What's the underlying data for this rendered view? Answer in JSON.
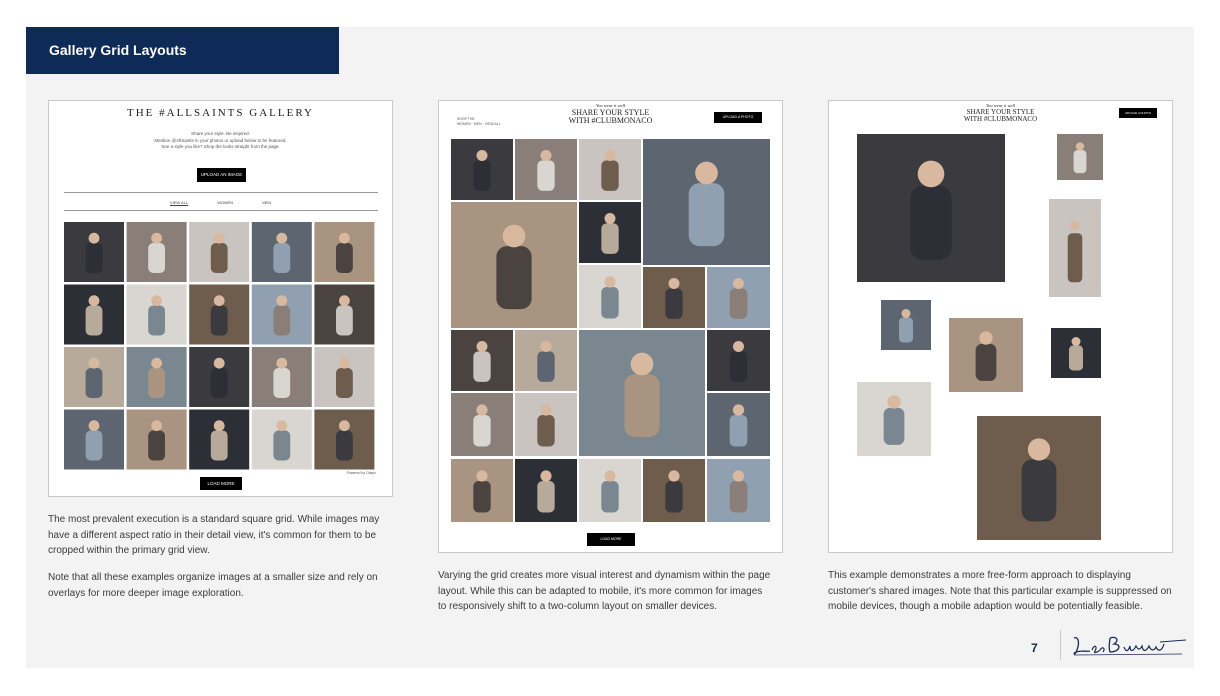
{
  "slide": {
    "title": "Gallery Grid Layouts",
    "page_number": "7",
    "logo_text": "Leo Burnett"
  },
  "panel1": {
    "title": "THE #ALLSAINTS GALLERY",
    "intro_lines": [
      "Share your style. Be inspired.",
      "Mention @AllSaints in your photos or upload below to be featured.",
      "See a style you like? Shop the looks straight from the page."
    ],
    "upload_button": "UPLOAD AN IMAGE",
    "filters": [
      "VIEW ALL",
      "WOMEN",
      "MEN"
    ],
    "powered_by": "Powered by Olapic",
    "load_more": "LOAD MORE"
  },
  "panel2": {
    "tagline": "You wear it well",
    "title_line1": "SHARE YOUR STYLE",
    "title_line2": "WITH #CLUBMONACO",
    "shop_label": "SHOP THE",
    "filter_text": "WOMEN · MEN · VIEW ALL",
    "upload_button": "UPLOAD A PHOTO",
    "load_more": "LOAD MORE"
  },
  "panel3": {
    "tagline": "You wear it well",
    "title_line1": "SHARE YOUR STYLE",
    "title_line2": "WITH #CLUBMONACO",
    "upload_button": "UPLOAD A PHOTO"
  },
  "captions": {
    "c1a": "The most prevalent execution is a standard square grid. While images may have a different aspect ratio in their detail view, it's common for them to be cropped within the primary grid view.",
    "c1b": "Note that all these examples organize images at a smaller size and rely on overlays for more deeper image exploration.",
    "c2": "Varying the grid creates more visual interest and dynamism within the page layout. While this can be adapted to mobile, it's more common for images to responsively shift to a two-column layout on smaller devices.",
    "c3": "This example demonstrates a more free-form approach to displaying customer's shared images. Note that this particular example is suppressed on mobile devices, though a mobile adaption would be potentially feasible."
  },
  "colors": {
    "title_bar": "#0e2a57",
    "slide_bg": "#f3f3f4"
  }
}
